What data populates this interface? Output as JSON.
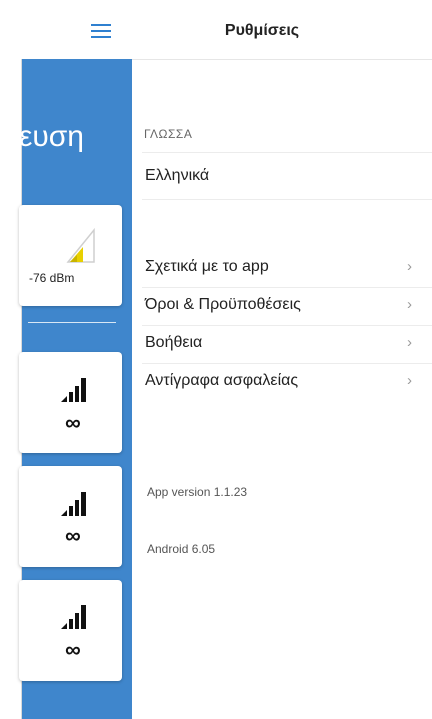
{
  "background_app": {
    "title_fragment": "ευση",
    "signal_value": "-76 dBm",
    "infinity_symbol": "∞",
    "menu_icon": "hamburger-icon",
    "signal_icon": "signal-bars-icon"
  },
  "settings": {
    "title": "Ρυθμίσεις",
    "language_section_label": "ΓΛΩΣΣΑ",
    "language_value": "Ελληνικά",
    "items": [
      {
        "label": "Σχετικά με το app",
        "icon": "chevron-right-icon"
      },
      {
        "label": "Όροι & Προϋποθέσεις",
        "icon": "chevron-right-icon"
      },
      {
        "label": "Βοήθεια",
        "icon": "chevron-right-icon"
      },
      {
        "label": "Αντίγραφα ασφαλείας",
        "icon": "chevron-right-icon"
      }
    ],
    "chevron": "›",
    "app_version": "App version 1.1.23",
    "android_version": "Android 6.05"
  },
  "colors": {
    "accent": "#3f86cc",
    "signal_yellow": "#e8d000"
  }
}
